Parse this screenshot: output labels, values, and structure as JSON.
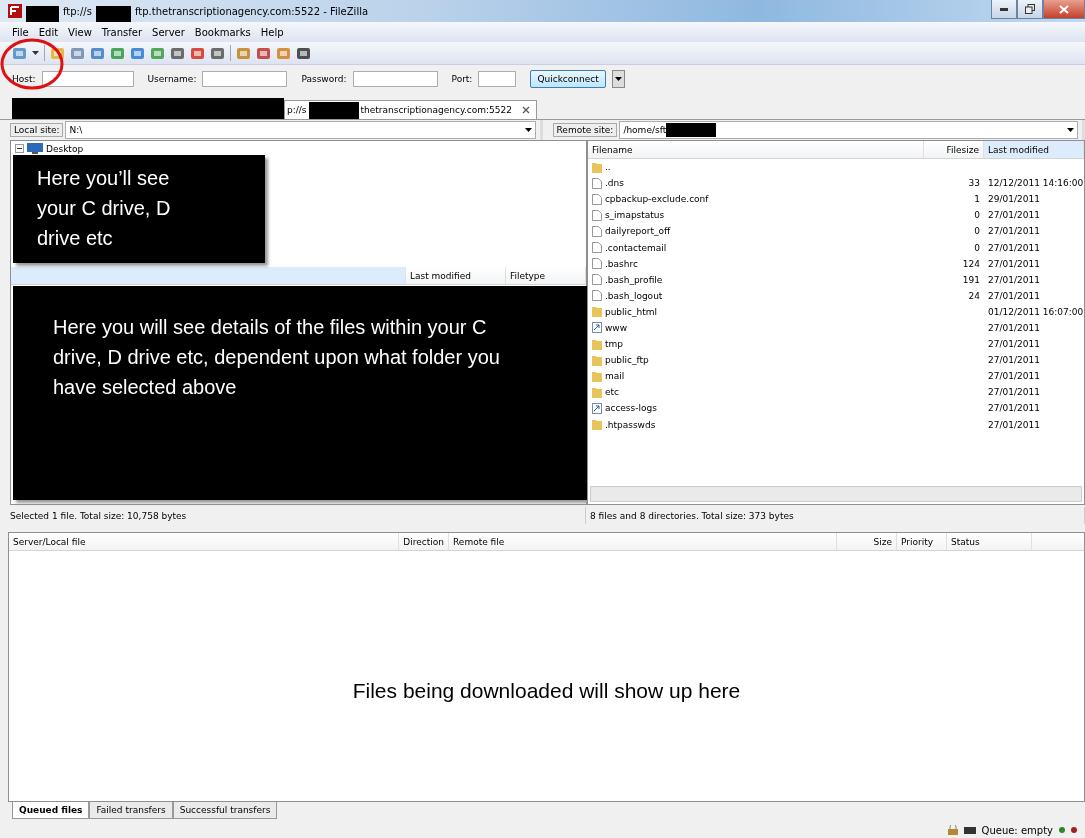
{
  "window": {
    "title_prefix": "ftp://s",
    "title_suffix": "ftp.thetranscriptionagency.com:5522 - FileZilla"
  },
  "menu": [
    "File",
    "Edit",
    "View",
    "Transfer",
    "Server",
    "Bookmarks",
    "Help"
  ],
  "quickconnect": {
    "host_label": "Host:",
    "username_label": "Username:",
    "password_label": "Password:",
    "port_label": "Port:",
    "button": "Quickconnect"
  },
  "tabs": [
    {
      "prefix": "p://s",
      "suffix": "thetranscriptionagency.com:5522",
      "selected": true
    }
  ],
  "local": {
    "label": "Local site:",
    "path": "N:\\",
    "tree": [
      {
        "label": "Desktop",
        "expanded": true
      }
    ],
    "columns": [
      "Last modified",
      "Filetype"
    ],
    "status": "Selected 1 file. Total size: 10,758 bytes"
  },
  "remote": {
    "label": "Remote site:",
    "path": "/home/sft",
    "columns": [
      "Filename",
      "Filesize",
      "Last modified"
    ],
    "rows": [
      {
        "kind": "folder",
        "name": "..",
        "size": "",
        "modified": ""
      },
      {
        "kind": "file",
        "name": ".dns",
        "size": "33",
        "modified": "12/12/2011 14:16:00"
      },
      {
        "kind": "file",
        "name": "cpbackup-exclude.conf",
        "size": "1",
        "modified": "29/01/2011"
      },
      {
        "kind": "file",
        "name": "s_imapstatus",
        "size": "0",
        "modified": "27/01/2011"
      },
      {
        "kind": "file",
        "name": "dailyreport_off",
        "size": "0",
        "modified": "27/01/2011"
      },
      {
        "kind": "file",
        "name": ".contactemail",
        "size": "0",
        "modified": "27/01/2011"
      },
      {
        "kind": "file",
        "name": ".bashrc",
        "size": "124",
        "modified": "27/01/2011"
      },
      {
        "kind": "file",
        "name": ".bash_profile",
        "size": "191",
        "modified": "27/01/2011"
      },
      {
        "kind": "file",
        "name": ".bash_logout",
        "size": "24",
        "modified": "27/01/2011"
      },
      {
        "kind": "folder",
        "name": "public_html",
        "size": "",
        "modified": "01/12/2011 16:07:00"
      },
      {
        "kind": "link",
        "name": "www",
        "size": "",
        "modified": "27/01/2011"
      },
      {
        "kind": "folder",
        "name": "tmp",
        "size": "",
        "modified": "27/01/2011"
      },
      {
        "kind": "folder",
        "name": "public_ftp",
        "size": "",
        "modified": "27/01/2011"
      },
      {
        "kind": "folder",
        "name": "mail",
        "size": "",
        "modified": "27/01/2011"
      },
      {
        "kind": "folder",
        "name": "etc",
        "size": "",
        "modified": "27/01/2011"
      },
      {
        "kind": "link",
        "name": "access-logs",
        "size": "",
        "modified": "27/01/2011"
      },
      {
        "kind": "folder",
        "name": ".htpasswds",
        "size": "",
        "modified": "27/01/2011"
      }
    ],
    "status": "8 files and 8 directories. Total size: 373 bytes"
  },
  "queue": {
    "columns": [
      "Server/Local file",
      "Direction",
      "Remote file",
      "Size",
      "Priority",
      "Status"
    ],
    "message": "Files being downloaded will show up here",
    "tabs": [
      {
        "label": "Queued files",
        "selected": true
      },
      {
        "label": "Failed transfers",
        "selected": false
      },
      {
        "label": "Successful transfers",
        "selected": false
      }
    ],
    "status": "Queue: empty"
  },
  "annotations": [
    "Here you’ll see your C drive, D drive etc",
    "Here you will see details of the files within your C drive, D drive etc, dependent upon what folder you have selected above"
  ]
}
